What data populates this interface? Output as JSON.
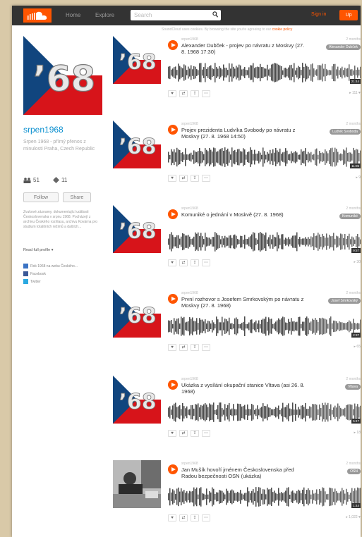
{
  "header": {
    "nav": [
      "Home",
      "Explore"
    ],
    "search_placeholder": "Search",
    "sign_in": "Sign in",
    "sign_up": "Up"
  },
  "subbar": {
    "text": "SoundCloud uses cookies. By browsing the site you're agreeing to our",
    "link": "cookie policy"
  },
  "profile": {
    "image_text": "’68",
    "name": "srpen1968",
    "desc": "Srpen 1968 - přímý přenos z minulosti Praha, Czech Republic",
    "followers": "51",
    "following": "11",
    "follow": "Follow",
    "share": "Share",
    "about": "Zvukové záznamy, dokumentující události Československa v srpnu 1968. Pocházejí z archivu Českého rozhlasu, archivu Kovárna pro studium totalitních režimů a dalších...",
    "read_more": "Read full profile ▾",
    "links": [
      {
        "label": "Rok 1968 na webu Českého...",
        "color": "#3b73c4"
      },
      {
        "label": "Facebook",
        "color": "#3b5998"
      },
      {
        "label": "Twitter",
        "color": "#2ba9e1"
      }
    ]
  },
  "tracks": [
    {
      "user": "srpen1968",
      "ago": "2 months",
      "title": "Alexander Dubček - projev po návratu z Moskvy (27. 8. 1968 17:30)",
      "tag": "Alexander Dubček",
      "plays": "▸ 111 ♥",
      "dur": "21:44",
      "thumb": "flag"
    },
    {
      "user": "srpen1968",
      "ago": "2 months",
      "title": "Projev prezidenta Ludvíka Svobody po návratu z Moskvy (27. 8. 1968 14:50)",
      "tag": "Ludvík Svoboda",
      "plays": "▸ 9",
      "dur": "11:06",
      "thumb": "flag"
    },
    {
      "user": "srpen1968",
      "ago": "2 months",
      "title": "Komuniké o jednání v Moskvě (27. 8. 1968)",
      "tag": "Komuniké",
      "plays": "▸ 30",
      "dur": "9:57",
      "thumb": "flag"
    },
    {
      "user": "srpen1968",
      "ago": "2 months",
      "title": "První rozhovor s Josefem Smrkovským po návratu z Moskvy (27. 8. 1968)",
      "tag": "Josef Smrkovský",
      "plays": "▸ 65",
      "dur": "2:37",
      "thumb": "flag"
    },
    {
      "user": "srpen1968",
      "ago": "2 months",
      "title": "Ukázka z vysílání okupační stanice Vltava (asi 26. 8. 1968)",
      "tag": "Vltava",
      "plays": "▸ 18",
      "dur": "5:47",
      "thumb": "flag"
    },
    {
      "user": "srpen1968",
      "ago": "2 months",
      "title": "Jan Mušík hovoří jménem Československa před Radou bezpečnosti OSN (ukázka)",
      "tag": "OSN",
      "plays": "▸ 1,022 ♥",
      "dur": "1:44",
      "thumb": "photo"
    }
  ],
  "colors": {
    "accent": "#ff5500",
    "flag_red": "#d7141a",
    "flag_blue": "#11457e",
    "link": "#0a8fcf"
  }
}
